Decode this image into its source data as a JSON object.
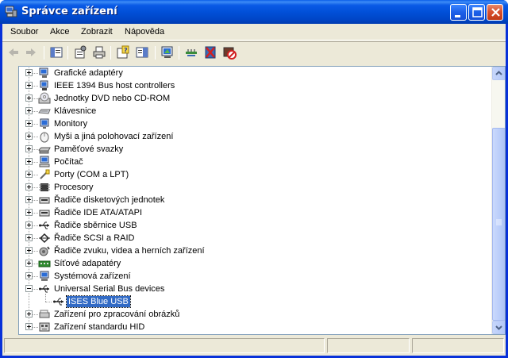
{
  "window": {
    "title": "Správce zařízení",
    "title_color": "#0054e3"
  },
  "menubar": {
    "items": [
      "Soubor",
      "Akce",
      "Zobrazit",
      "Nápověda"
    ]
  },
  "toolbar": {
    "buttons": [
      "back-icon",
      "forward-icon",
      "show-hide-console-tree-icon",
      "properties-icon",
      "print-icon",
      "help-icon",
      "show-action-pane-icon",
      "scan-hardware-icon",
      "update-driver-icon",
      "uninstall-icon",
      "disable-icon"
    ]
  },
  "tree": {
    "selected_color": "#316ac5",
    "items": [
      {
        "label": "Grafické adaptéry",
        "icon": "display-adapter-icon",
        "level": 0,
        "expander": "+"
      },
      {
        "label": "IEEE 1394 Bus host controllers",
        "icon": "ieee1394-icon",
        "level": 0,
        "expander": "+"
      },
      {
        "label": "Jednotky DVD nebo CD-ROM",
        "icon": "cdrom-icon",
        "level": 0,
        "expander": "+"
      },
      {
        "label": "Klávesnice",
        "icon": "keyboard-icon",
        "level": 0,
        "expander": "+"
      },
      {
        "label": "Monitory",
        "icon": "monitor-icon",
        "level": 0,
        "expander": "+"
      },
      {
        "label": "Myši a jiná polohovací zařízení",
        "icon": "mouse-icon",
        "level": 0,
        "expander": "+"
      },
      {
        "label": "Paměťové svazky",
        "icon": "storage-volume-icon",
        "level": 0,
        "expander": "+"
      },
      {
        "label": "Počítač",
        "icon": "computer-icon",
        "level": 0,
        "expander": "+"
      },
      {
        "label": "Porty (COM a LPT)",
        "icon": "port-icon",
        "level": 0,
        "expander": "+"
      },
      {
        "label": "Procesory",
        "icon": "processor-icon",
        "level": 0,
        "expander": "+"
      },
      {
        "label": "Řadiče disketových jednotek",
        "icon": "floppy-controller-icon",
        "level": 0,
        "expander": "+"
      },
      {
        "label": "Řadiče IDE ATA/ATAPI",
        "icon": "ide-controller-icon",
        "level": 0,
        "expander": "+"
      },
      {
        "label": "Řadiče sběrnice USB",
        "icon": "usb-icon",
        "level": 0,
        "expander": "+"
      },
      {
        "label": "Řadiče SCSI a RAID",
        "icon": "scsi-icon",
        "level": 0,
        "expander": "+"
      },
      {
        "label": "Řadiče zvuku, videa a herních zařízení",
        "icon": "sound-icon",
        "level": 0,
        "expander": "+"
      },
      {
        "label": "Síťové adapatéry",
        "icon": "network-adapter-icon",
        "level": 0,
        "expander": "+"
      },
      {
        "label": "Systémová zařízení",
        "icon": "system-device-icon",
        "level": 0,
        "expander": "+"
      },
      {
        "label": "Universal Serial Bus devices",
        "icon": "usb-icon",
        "level": 0,
        "expander": "-"
      },
      {
        "label": "ISES Blue USB",
        "icon": "usb-icon",
        "level": 1,
        "expander": "",
        "selected": true
      },
      {
        "label": "Zařízení pro zpracování obrázků",
        "icon": "imaging-device-icon",
        "level": 0,
        "expander": "+"
      },
      {
        "label": "Zařízení standardu HID",
        "icon": "hid-icon",
        "level": 0,
        "expander": "+"
      }
    ]
  },
  "statusbar": {
    "panes": [
      "",
      "",
      ""
    ]
  }
}
